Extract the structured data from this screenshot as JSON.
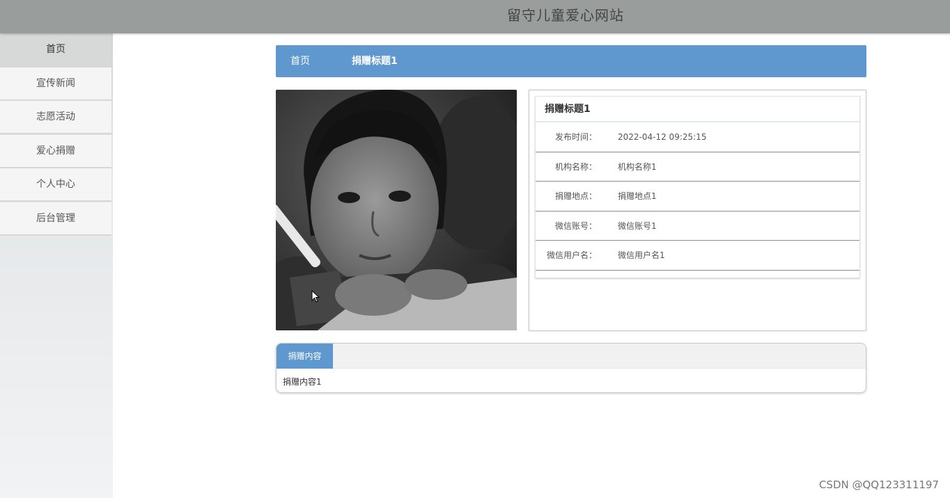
{
  "header": {
    "site_title": "留守儿童爱心网站"
  },
  "sidebar": {
    "items": [
      {
        "label": "首页",
        "active": true
      },
      {
        "label": "宣传新闻"
      },
      {
        "label": "志愿活动"
      },
      {
        "label": "爱心捐赠"
      },
      {
        "label": "个人中心"
      },
      {
        "label": "后台管理"
      }
    ]
  },
  "breadcrumb": {
    "home": "首页",
    "current": "捐赠标题1"
  },
  "detail": {
    "image_icon": "photo-child-writing",
    "title": "捐赠标题1",
    "fields": [
      {
        "label": "发布时间：",
        "value": "2022-04-12 09:25:15"
      },
      {
        "label": "机构名称：",
        "value": "机构名称1"
      },
      {
        "label": "捐赠地点：",
        "value": "捐赠地点1"
      },
      {
        "label": "微信账号：",
        "value": "微信账号1"
      },
      {
        "label": "微信用户名：",
        "value": "微信用户名1"
      }
    ]
  },
  "tabs": {
    "active_label": "捐赠内容",
    "content": "捐赠内容1"
  },
  "watermark": "CSDN @QQ123311197",
  "colors": {
    "topbar": "#999d9c",
    "accent": "#5f97cf"
  }
}
